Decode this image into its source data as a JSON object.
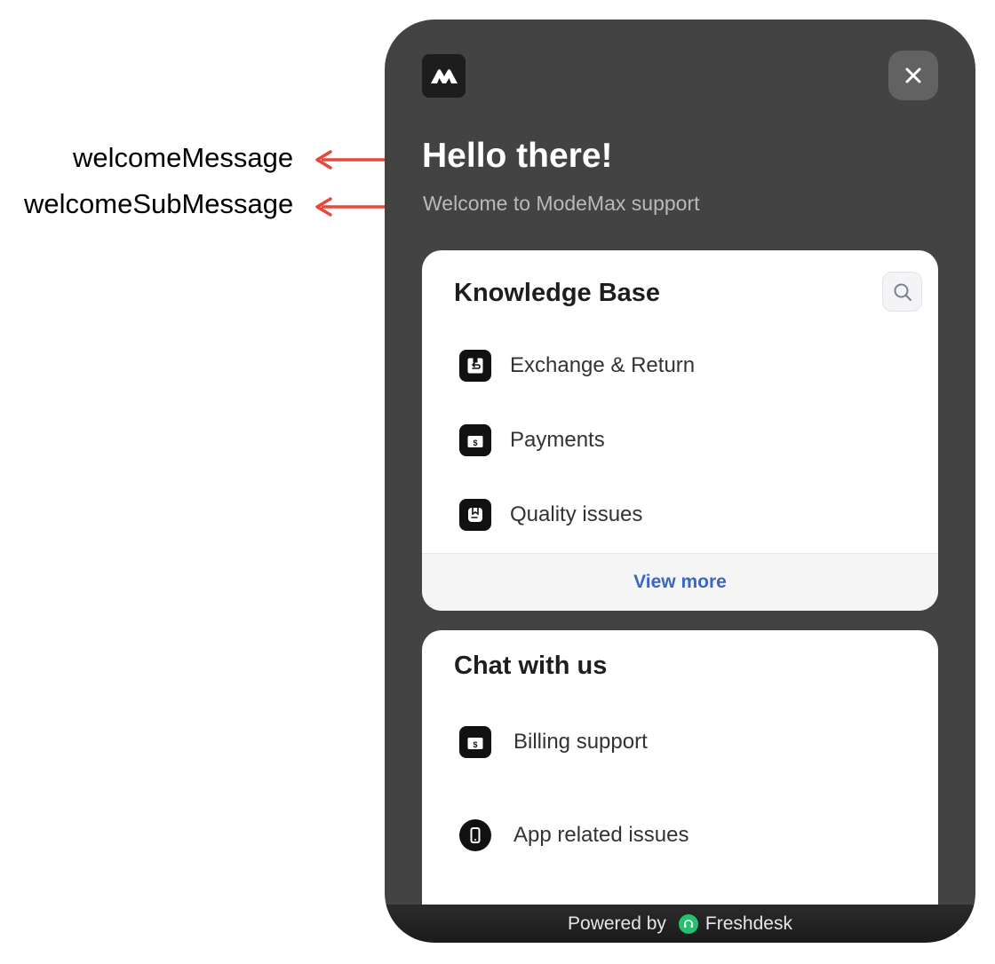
{
  "annotations": {
    "welcome": "welcomeMessage",
    "sub": "welcomeSubMessage",
    "arrow_color": "#e8473a"
  },
  "header": {
    "logo_icon": "modemax-logo",
    "close_icon": "close-icon",
    "welcome": "Hello there!",
    "sub": "Welcome to ModeMax support"
  },
  "knowledge_base": {
    "title": "Knowledge Base",
    "search_icon": "search-icon",
    "items": [
      {
        "label": "Exchange & Return",
        "icon": "return-box-icon"
      },
      {
        "label": "Payments",
        "icon": "payment-icon"
      },
      {
        "label": "Quality issues",
        "icon": "quality-tag-icon"
      }
    ],
    "view_more": "View more",
    "link_color": "#3a66c2"
  },
  "chat": {
    "title": "Chat with us",
    "items": [
      {
        "label": "Billing support",
        "icon": "billing-icon"
      },
      {
        "label": "App related issues",
        "icon": "phone-icon"
      }
    ]
  },
  "footer": {
    "powered_by": "Powered by",
    "brand": "Freshdesk",
    "brand_color": "#25c16f"
  },
  "theme": {
    "widget_bg": "#434343",
    "card_bg": "#ffffff"
  }
}
